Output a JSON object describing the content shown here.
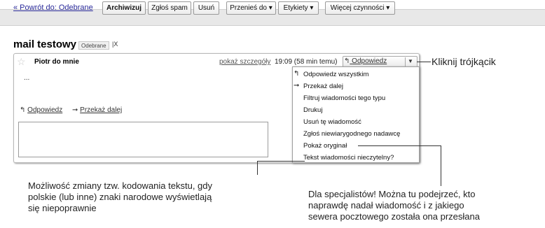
{
  "toolbar": {
    "back_link": "« Powrót do: Odebrane",
    "buttons": [
      "Archiwizuj",
      "Zgłoś spam",
      "Usuń",
      "Przenieś do ▾",
      "Etykiety ▾",
      "Więcej czynności ▾"
    ]
  },
  "message": {
    "subject": "mail testowy",
    "label": "Odebrane",
    "label_remove": "X",
    "sender": "Piotr do mnie",
    "details_link": "pokaż szczegóły",
    "time": "19:09 (58 min temu)",
    "reply_button": "Odpowiedz",
    "reply_dropdown": "▼",
    "body_snippet": "...",
    "bottom_reply": "Odpowiedz",
    "bottom_forward": "Przekaż dalej"
  },
  "menu": {
    "items": [
      "Odpowiedz wszystkim",
      "Przekaż dalej",
      "Filtruj wiadomości tego typu",
      "Drukuj",
      "Usuń tę wiadomość",
      "Zgłoś niewiarygodnego nadawcę",
      "Pokaż oryginał",
      "Tekst wiadomości nieczytelny?"
    ]
  },
  "annotations": {
    "click_triangle": "Kliknij trójkącik",
    "encoding_note_line1": "Możliwość zmiany tzw. kodowania tekstu, gdy",
    "encoding_note_line2": "polskie (lub inne) znaki narodowe wyświetlają",
    "encoding_note_line3": "się niepoprawnie",
    "specialists_line1": "Dla specjalistów! Można tu podejrzeć, kto",
    "specialists_line2": "naprawdę nadał wiadomość i z jakiego",
    "specialists_line3": "sewera pocztowego została ona przesłana"
  },
  "icons": {
    "star": "star-icon",
    "reply": "reply-arrow-icon",
    "reply_all": "reply-all-icon",
    "forward": "forward-arrow-icon"
  }
}
